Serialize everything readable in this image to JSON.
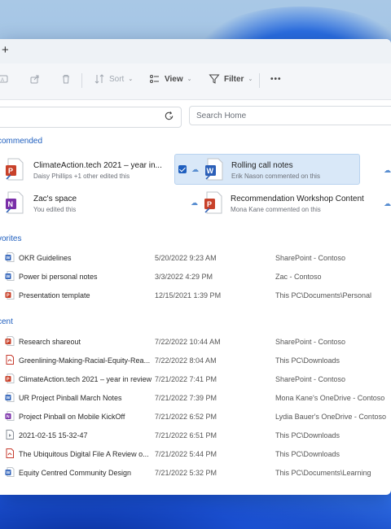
{
  "toolbar": {
    "sort_label": "Sort",
    "view_label": "View",
    "filter_label": "Filter",
    "more_label": "•••"
  },
  "search": {
    "placeholder": "Search Home"
  },
  "sections": {
    "recommended": "commended",
    "favorites": "vorites",
    "recent": "cent"
  },
  "recommended": [
    {
      "title": "ClimateAction.tech 2021 – year in...",
      "subtitle": "Daisy Phillips +1 other edited this",
      "app": "powerpoint"
    },
    {
      "title": "Rolling call notes",
      "subtitle": "Erik Nason commented on this",
      "app": "word",
      "selected": true
    },
    {
      "title": "Zac's space",
      "subtitle": "You edited this",
      "app": "onenote"
    },
    {
      "title": "Recommendation Workshop Content",
      "subtitle": "Mona Kane commented on this",
      "app": "powerpoint"
    }
  ],
  "favorites": [
    {
      "name": "OKR Guidelines",
      "date": "5/20/2022 9:23 AM",
      "location": "SharePoint - Contoso",
      "icon": "word"
    },
    {
      "name": "Power bi personal notes",
      "date": "3/3/2022 4:29 PM",
      "location": "Zac - Contoso",
      "icon": "word"
    },
    {
      "name": "Presentation template",
      "date": "12/15/2021 1:39 PM",
      "location": "This PC\\Documents\\Personal",
      "icon": "powerpoint"
    }
  ],
  "recent": [
    {
      "name": "Research shareout",
      "date": "7/22/2022 10:44 AM",
      "location": "SharePoint - Contoso",
      "icon": "powerpoint"
    },
    {
      "name": "Greenlining-Making-Racial-Equity-Rea...",
      "date": "7/22/2022 8:04 AM",
      "location": "This PC\\Downloads",
      "icon": "pdf"
    },
    {
      "name": "ClimateAction.tech 2021 – year in review",
      "date": "7/21/2022 7:41 PM",
      "location": "SharePoint - Contoso",
      "icon": "powerpoint"
    },
    {
      "name": "UR Project Pinball March Notes",
      "date": "7/21/2022 7:39 PM",
      "location": "Mona Kane's OneDrive - Contoso",
      "icon": "word"
    },
    {
      "name": "Project Pinball on Mobile KickOff",
      "date": "7/21/2022 6:52 PM",
      "location": "Lydia Bauer's OneDrive - Contoso",
      "icon": "onenote"
    },
    {
      "name": "2021-02-15 15-32-47",
      "date": "7/21/2022 6:51 PM",
      "location": "This PC\\Downloads",
      "icon": "file"
    },
    {
      "name": "The Ubiquitous Digital File A Review o...",
      "date": "7/21/2022 5:44 PM",
      "location": "This PC\\Downloads",
      "icon": "pdf"
    },
    {
      "name": "Equity Centred Community Design",
      "date": "7/21/2022 5:32 PM",
      "location": "This PC\\Documents\\Learning",
      "icon": "word"
    }
  ],
  "colors": {
    "accent": "#1f5fbf",
    "word": "#2b5fb8",
    "powerpoint": "#c8412a",
    "onenote": "#7a2fa8",
    "pdf": "#c63a2d"
  }
}
